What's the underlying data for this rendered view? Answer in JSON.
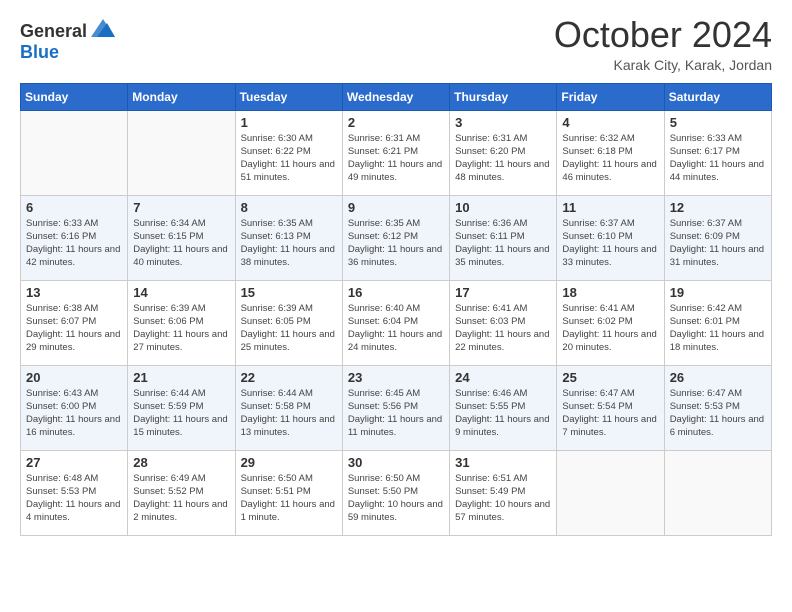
{
  "header": {
    "logo_general": "General",
    "logo_blue": "Blue",
    "month_title": "October 2024",
    "location": "Karak City, Karak, Jordan"
  },
  "days_of_week": [
    "Sunday",
    "Monday",
    "Tuesday",
    "Wednesday",
    "Thursday",
    "Friday",
    "Saturday"
  ],
  "weeks": [
    [
      {
        "day": "",
        "info": ""
      },
      {
        "day": "",
        "info": ""
      },
      {
        "day": "1",
        "info": "Sunrise: 6:30 AM\nSunset: 6:22 PM\nDaylight: 11 hours and 51 minutes."
      },
      {
        "day": "2",
        "info": "Sunrise: 6:31 AM\nSunset: 6:21 PM\nDaylight: 11 hours and 49 minutes."
      },
      {
        "day": "3",
        "info": "Sunrise: 6:31 AM\nSunset: 6:20 PM\nDaylight: 11 hours and 48 minutes."
      },
      {
        "day": "4",
        "info": "Sunrise: 6:32 AM\nSunset: 6:18 PM\nDaylight: 11 hours and 46 minutes."
      },
      {
        "day": "5",
        "info": "Sunrise: 6:33 AM\nSunset: 6:17 PM\nDaylight: 11 hours and 44 minutes."
      }
    ],
    [
      {
        "day": "6",
        "info": "Sunrise: 6:33 AM\nSunset: 6:16 PM\nDaylight: 11 hours and 42 minutes."
      },
      {
        "day": "7",
        "info": "Sunrise: 6:34 AM\nSunset: 6:15 PM\nDaylight: 11 hours and 40 minutes."
      },
      {
        "day": "8",
        "info": "Sunrise: 6:35 AM\nSunset: 6:13 PM\nDaylight: 11 hours and 38 minutes."
      },
      {
        "day": "9",
        "info": "Sunrise: 6:35 AM\nSunset: 6:12 PM\nDaylight: 11 hours and 36 minutes."
      },
      {
        "day": "10",
        "info": "Sunrise: 6:36 AM\nSunset: 6:11 PM\nDaylight: 11 hours and 35 minutes."
      },
      {
        "day": "11",
        "info": "Sunrise: 6:37 AM\nSunset: 6:10 PM\nDaylight: 11 hours and 33 minutes."
      },
      {
        "day": "12",
        "info": "Sunrise: 6:37 AM\nSunset: 6:09 PM\nDaylight: 11 hours and 31 minutes."
      }
    ],
    [
      {
        "day": "13",
        "info": "Sunrise: 6:38 AM\nSunset: 6:07 PM\nDaylight: 11 hours and 29 minutes."
      },
      {
        "day": "14",
        "info": "Sunrise: 6:39 AM\nSunset: 6:06 PM\nDaylight: 11 hours and 27 minutes."
      },
      {
        "day": "15",
        "info": "Sunrise: 6:39 AM\nSunset: 6:05 PM\nDaylight: 11 hours and 25 minutes."
      },
      {
        "day": "16",
        "info": "Sunrise: 6:40 AM\nSunset: 6:04 PM\nDaylight: 11 hours and 24 minutes."
      },
      {
        "day": "17",
        "info": "Sunrise: 6:41 AM\nSunset: 6:03 PM\nDaylight: 11 hours and 22 minutes."
      },
      {
        "day": "18",
        "info": "Sunrise: 6:41 AM\nSunset: 6:02 PM\nDaylight: 11 hours and 20 minutes."
      },
      {
        "day": "19",
        "info": "Sunrise: 6:42 AM\nSunset: 6:01 PM\nDaylight: 11 hours and 18 minutes."
      }
    ],
    [
      {
        "day": "20",
        "info": "Sunrise: 6:43 AM\nSunset: 6:00 PM\nDaylight: 11 hours and 16 minutes."
      },
      {
        "day": "21",
        "info": "Sunrise: 6:44 AM\nSunset: 5:59 PM\nDaylight: 11 hours and 15 minutes."
      },
      {
        "day": "22",
        "info": "Sunrise: 6:44 AM\nSunset: 5:58 PM\nDaylight: 11 hours and 13 minutes."
      },
      {
        "day": "23",
        "info": "Sunrise: 6:45 AM\nSunset: 5:56 PM\nDaylight: 11 hours and 11 minutes."
      },
      {
        "day": "24",
        "info": "Sunrise: 6:46 AM\nSunset: 5:55 PM\nDaylight: 11 hours and 9 minutes."
      },
      {
        "day": "25",
        "info": "Sunrise: 6:47 AM\nSunset: 5:54 PM\nDaylight: 11 hours and 7 minutes."
      },
      {
        "day": "26",
        "info": "Sunrise: 6:47 AM\nSunset: 5:53 PM\nDaylight: 11 hours and 6 minutes."
      }
    ],
    [
      {
        "day": "27",
        "info": "Sunrise: 6:48 AM\nSunset: 5:53 PM\nDaylight: 11 hours and 4 minutes."
      },
      {
        "day": "28",
        "info": "Sunrise: 6:49 AM\nSunset: 5:52 PM\nDaylight: 11 hours and 2 minutes."
      },
      {
        "day": "29",
        "info": "Sunrise: 6:50 AM\nSunset: 5:51 PM\nDaylight: 11 hours and 1 minute."
      },
      {
        "day": "30",
        "info": "Sunrise: 6:50 AM\nSunset: 5:50 PM\nDaylight: 10 hours and 59 minutes."
      },
      {
        "day": "31",
        "info": "Sunrise: 6:51 AM\nSunset: 5:49 PM\nDaylight: 10 hours and 57 minutes."
      },
      {
        "day": "",
        "info": ""
      },
      {
        "day": "",
        "info": ""
      }
    ]
  ]
}
